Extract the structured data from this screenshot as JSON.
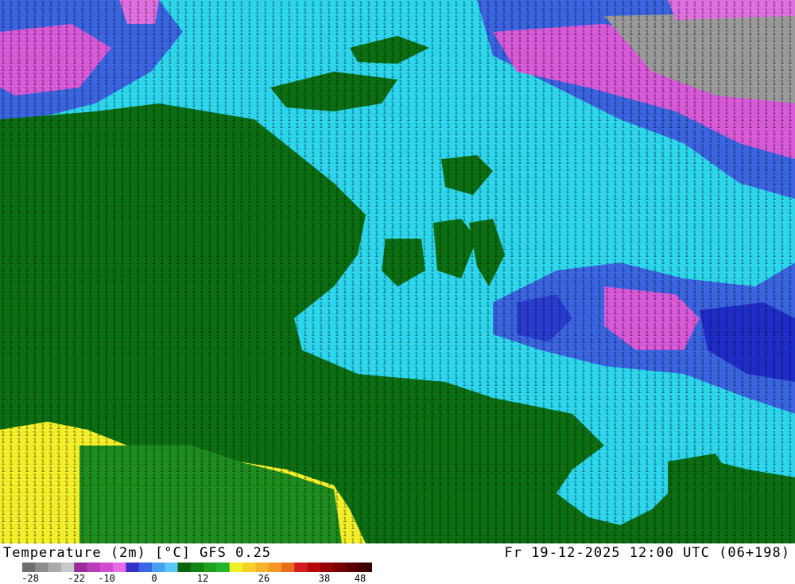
{
  "footer": {
    "title_left": "Temperature (2m) [°C] GFS 0.25",
    "title_right": "Fr 19-12-2025 12:00 UTC (06+198)"
  },
  "legend": {
    "colors": [
      "#6e6e6e",
      "#8c8c8c",
      "#aaaaaa",
      "#c8c8c8",
      "#9b2d9b",
      "#b93cb9",
      "#d24bd2",
      "#e66be6",
      "#3232c8",
      "#3c64e6",
      "#46a0f0",
      "#5ac8f5",
      "#0a640a",
      "#148214",
      "#1ea01e",
      "#28b428",
      "#f0f028",
      "#f5d228",
      "#f5b428",
      "#f59628",
      "#e66e1e",
      "#d21e1e",
      "#b40a0a",
      "#960000",
      "#780000",
      "#5a0000",
      "#3c0000"
    ],
    "ticks": [
      "-28",
      "-22",
      "-10",
      "0",
      "12",
      "26",
      "38",
      "48"
    ]
  }
}
